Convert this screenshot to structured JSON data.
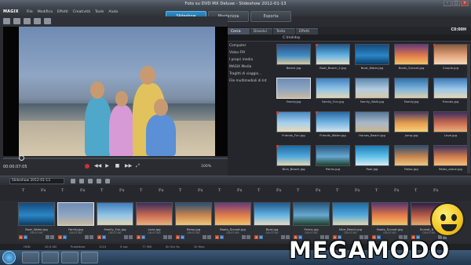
{
  "window": {
    "title": "Foto su DVD MX Deluxe - Slideshow 2012-01-13"
  },
  "menu": {
    "logo": "MAGIX",
    "items": [
      "File",
      "Modifica",
      "Effetti",
      "Creatività",
      "Tools",
      "Aiuto"
    ]
  },
  "modes": [
    {
      "label": "Slideshow",
      "active": true
    },
    {
      "label": "Masterizza",
      "active": false
    },
    {
      "label": "Esporta",
      "active": false
    }
  ],
  "preview": {
    "timecode": "00:00:07:05",
    "zoom": "100%"
  },
  "browser": {
    "tabs": [
      "Cerca",
      "Dissolvi",
      "Testo",
      "Effetti"
    ],
    "path": "C:\\Holiday",
    "drive_label": "C0:00H",
    "tree": [
      "Computer",
      "Video-FM",
      "I propri media",
      "MAGIX Media",
      "Tragitti di viaggio...",
      "File multimediali di Int"
    ],
    "thumbs": [
      {
        "name": "Beach.jpg",
        "colors": [
          "#2d4a7a",
          "#3f8cc6",
          "#d8c9a1"
        ],
        "marked": false
      },
      {
        "name": "Boat_Beach_2.jpg",
        "colors": [
          "#1f5a8f",
          "#63b3e3",
          "#e6dcc2"
        ],
        "marked": true
      },
      {
        "name": "Boat_Water.jpg",
        "colors": [
          "#164a7c",
          "#2a86c6",
          "#0d3b63"
        ],
        "marked": false
      },
      {
        "name": "Boats_Sunset.jpg",
        "colors": [
          "#6b3a7a",
          "#e07a4a",
          "#f0c36a"
        ],
        "marked": false
      },
      {
        "name": "Couple.jpg",
        "colors": [
          "#8d5b3e",
          "#e2a37a",
          "#f5d9b8"
        ],
        "marked": true
      },
      {
        "name": "Family.jpg",
        "colors": [
          "#6f8bb3",
          "#8fa6c4",
          "#c9b99c"
        ],
        "marked": false
      },
      {
        "name": "Family_Fun.jpg",
        "colors": [
          "#3f7fbf",
          "#91c4e6",
          "#e3d5b3"
        ],
        "marked": false
      },
      {
        "name": "Family_Walk.jpg",
        "colors": [
          "#5a86ad",
          "#b4cde0",
          "#d9c8a6"
        ],
        "marked": false
      },
      {
        "name": "Family.jpg",
        "colors": [
          "#2f6fa8",
          "#7fb6dd",
          "#e0cfa9"
        ],
        "marked": false
      },
      {
        "name": "Friends.jpg",
        "colors": [
          "#3a79b8",
          "#9cc8ea",
          "#e6d7b4"
        ],
        "marked": false
      },
      {
        "name": "Friends_Fun.jpg",
        "colors": [
          "#4a8ac4",
          "#a6d0ee",
          "#e8d9b8"
        ],
        "marked": true
      },
      {
        "name": "Friends_Water.jpg",
        "colors": [
          "#2a6aa6",
          "#77b7e3",
          "#d2e2ea"
        ],
        "marked": true
      },
      {
        "name": "Horses_Beach.jpg",
        "colors": [
          "#58789a",
          "#a8b9c8",
          "#c9b58f"
        ],
        "marked": false
      },
      {
        "name": "Jump.jpg",
        "colors": [
          "#4a3a62",
          "#e59b4c",
          "#f6d27a"
        ],
        "marked": false
      },
      {
        "name": "Love.jpg",
        "colors": [
          "#3b2e5c",
          "#c96a52",
          "#eab07a"
        ],
        "marked": false
      },
      {
        "name": "Nice_Beach.jpg",
        "colors": [
          "#1e6aa4",
          "#52a9dc",
          "#e4d6b0"
        ],
        "marked": true
      },
      {
        "name": "Palms.jpg",
        "colors": [
          "#23567f",
          "#68a8d1",
          "#1e3f2a"
        ],
        "marked": false
      },
      {
        "name": "Pool.jpg",
        "colors": [
          "#1c7bb5",
          "#62c1e8",
          "#d7ecf2"
        ],
        "marked": false
      },
      {
        "name": "Relax.jpg",
        "colors": [
          "#2b4f73",
          "#c7854f",
          "#f0c77e"
        ],
        "marked": false
      },
      {
        "name": "Relax_alone.jpg",
        "colors": [
          "#37315c",
          "#d27b4f",
          "#f3c07b"
        ],
        "marked": false
      }
    ]
  },
  "timeline": {
    "name": "Slideshow 2012-01-13",
    "clips": [
      {
        "name": "Boat_Water.jpg",
        "time": "00:07:00",
        "colors": [
          "#164a7c",
          "#2a86c6",
          "#0d3b63"
        ]
      },
      {
        "name": "Family.jpg",
        "time": "00:07:00",
        "colors": [
          "#6f8bb3",
          "#8fa6c4",
          "#c9b99c"
        ]
      },
      {
        "name": "Family_Fun.jpg",
        "time": "00:07:00",
        "colors": [
          "#3f7fbf",
          "#91c4e6",
          "#e3d5b3"
        ]
      },
      {
        "name": "Love.jpg",
        "time": "00:07:00",
        "colors": [
          "#3b2e5c",
          "#c96a52",
          "#eab07a"
        ]
      },
      {
        "name": "Relax.jpg",
        "time": "00:07:00",
        "colors": [
          "#2b4f73",
          "#c7854f",
          "#f0c77e"
        ]
      },
      {
        "name": "Boats_Sunset.jpg",
        "time": "00:07:00",
        "colors": [
          "#6b3a7a",
          "#e07a4a",
          "#f0c36a"
        ]
      },
      {
        "name": "Boat.jpg",
        "time": "00:07:00",
        "colors": [
          "#1f5a8f",
          "#63b3e3",
          "#e6dcc2"
        ]
      },
      {
        "name": "Palms.jpg",
        "time": "00:07:00",
        "colors": [
          "#23567f",
          "#68a8d1",
          "#1e3f2a"
        ]
      },
      {
        "name": "Nice_Beach.jpg",
        "time": "00:07:00",
        "colors": [
          "#1e6aa4",
          "#52a9dc",
          "#e4d6b0"
        ]
      },
      {
        "name": "Boats_Sunset.jpg",
        "time": "00:07:00",
        "colors": [
          "#5a3470",
          "#e47a48",
          "#f2c46a"
        ]
      },
      {
        "name": "Sunset_Be...",
        "time": "00:07:00",
        "colors": [
          "#2a1f4a",
          "#b75a46",
          "#e9a86a"
        ]
      }
    ]
  },
  "status": [
    "HDD",
    "10,0 GB",
    "Proiettore",
    "0:24",
    "0 sec",
    "77 MB",
    "0h 5m 9s",
    "10 files"
  ],
  "watermark": "MEGAMODO"
}
